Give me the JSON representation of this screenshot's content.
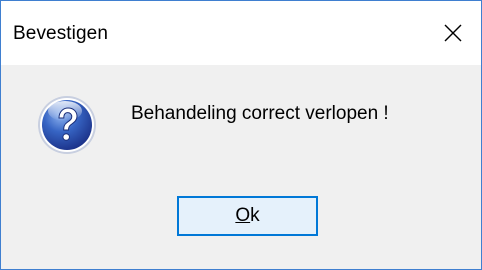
{
  "window": {
    "title": "Bevestigen",
    "close_icon": "close-icon",
    "border_color": "#3f7fd0"
  },
  "dialog": {
    "icon": "question-icon",
    "message": "Behandeling correct verlopen !",
    "background": "#f0f0f0"
  },
  "buttons": {
    "ok_mnemonic": "O",
    "ok_rest": "k",
    "ok_border_color": "#0078d7",
    "ok_background": "#e5f1fb"
  }
}
